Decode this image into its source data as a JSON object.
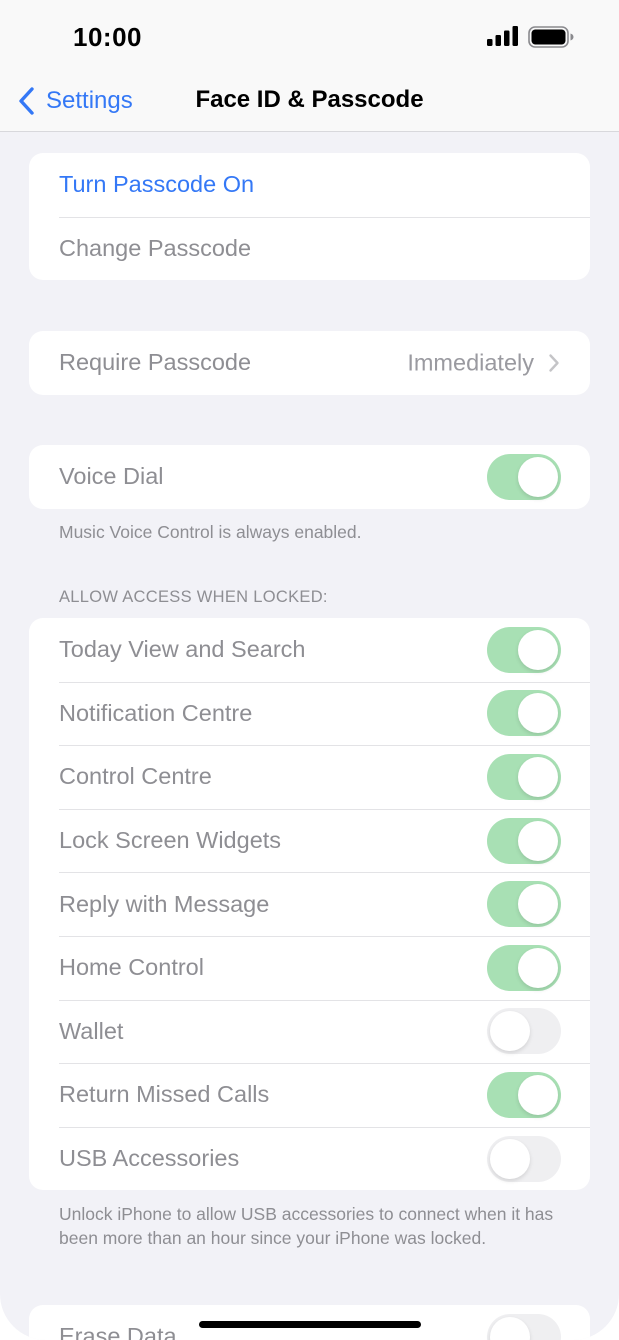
{
  "status_bar": {
    "time": "10:00",
    "signal_icon": "signal-bars-icon",
    "battery_icon": "battery-full-icon"
  },
  "nav": {
    "back_label": "Settings",
    "back_icon": "chevron-left-icon",
    "title": "Face ID & Passcode"
  },
  "passcode_group": {
    "turn_on_label": "Turn Passcode On",
    "change_label": "Change Passcode"
  },
  "require_group": {
    "label": "Require Passcode",
    "value": "Immediately"
  },
  "voice_group": {
    "label": "Voice Dial",
    "enabled": true,
    "footnote": "Music Voice Control is always enabled."
  },
  "access": {
    "header": "ALLOW ACCESS WHEN LOCKED:",
    "items": [
      {
        "label": "Today View and Search",
        "enabled": true
      },
      {
        "label": "Notification Centre",
        "enabled": true
      },
      {
        "label": "Control Centre",
        "enabled": true
      },
      {
        "label": "Lock Screen Widgets",
        "enabled": true
      },
      {
        "label": "Reply with Message",
        "enabled": true
      },
      {
        "label": "Home Control",
        "enabled": true
      },
      {
        "label": "Wallet",
        "enabled": false
      },
      {
        "label": "Return Missed Calls",
        "enabled": true
      },
      {
        "label": "USB Accessories",
        "enabled": false
      }
    ],
    "footnote": "Unlock iPhone to allow USB accessories to connect when it has been more than an hour since your iPhone was locked."
  },
  "erase_group": {
    "label": "Erase Data",
    "enabled": false
  },
  "colors": {
    "accent": "#3478f6",
    "toggle_on": "#a8e0b4",
    "toggle_off": "#efeff1",
    "background": "#f2f2f7"
  }
}
